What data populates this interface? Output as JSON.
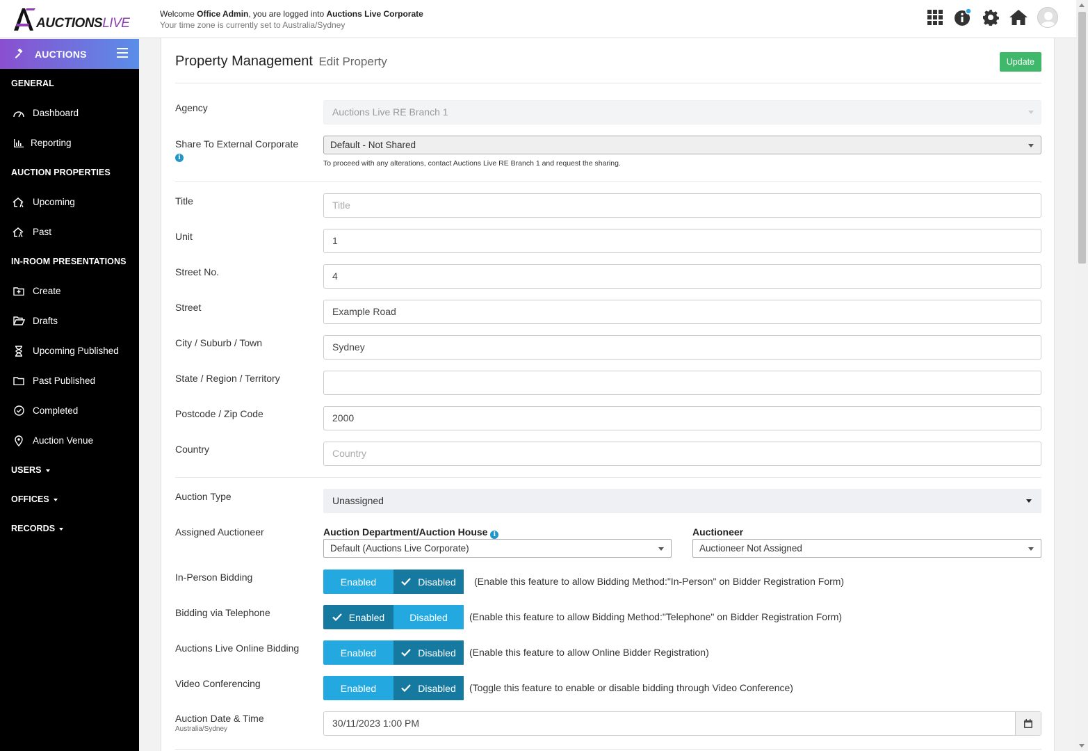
{
  "header": {
    "logo_main": "AUCTIONS",
    "logo_accent": "LIVE",
    "welcome_prefix": "Welcome ",
    "user_name": "Office Admin",
    "welcome_mid": ", you are logged into ",
    "org_name": "Auctions Live Corporate",
    "timezone_text": "Your time zone is currently set to Australia/Sydney",
    "icons": [
      "apps-grid-icon",
      "info-icon",
      "gear-icon",
      "home-icon",
      "user-avatar"
    ]
  },
  "sidebar": {
    "head_label": "AUCTIONS",
    "general_title": "GENERAL",
    "general_items": [
      "Dashboard",
      "Reporting"
    ],
    "auction_properties_title": "AUCTION PROPERTIES",
    "auction_properties_items": [
      "Upcoming",
      "Past"
    ],
    "inroom_title": "IN-ROOM PRESENTATIONS",
    "inroom_items": [
      "Create",
      "Drafts",
      "Upcoming Published",
      "Past Published",
      "Completed",
      "Auction Venue"
    ],
    "users_label": "USERS",
    "offices_label": "OFFICES",
    "records_label": "RECORDS"
  },
  "page": {
    "title": "Property Management",
    "subtitle": "Edit Property",
    "update_label": "Update"
  },
  "form": {
    "agency_label": "Agency",
    "agency_value": "Auctions Live RE Branch 1",
    "share_label": "Share To External Corporate",
    "share_value": "Default - Not Shared",
    "share_note": "To proceed with any alterations, contact Auctions Live RE Branch 1 and request the sharing.",
    "title_label": "Title",
    "title_placeholder": "Title",
    "unit_label": "Unit",
    "unit_value": "1",
    "street_no_label": "Street No.",
    "street_no_value": "4",
    "street_label": "Street",
    "street_value": "Example Road",
    "city_label": "City / Suburb / Town",
    "city_value": "Sydney",
    "state_label": "State / Region / Territory",
    "state_value": "",
    "postcode_label": "Postcode / Zip Code",
    "postcode_value": "2000",
    "country_label": "Country",
    "country_placeholder": "Country",
    "auction_type_label": "Auction Type",
    "auction_type_value": "Unassigned",
    "assigned_auctioneer_label": "Assigned Auctioneer",
    "dept_label": "Auction Department/Auction House",
    "dept_value": "Default (Auctions Live Corporate)",
    "auctioneer_label": "Auctioneer",
    "auctioneer_value": "Auctioneer Not Assigned",
    "toggle_enabled": "Enabled",
    "toggle_disabled": "Disabled",
    "inperson_label": "In-Person Bidding",
    "inperson_desc": "(Enable this feature to allow Bidding Method:\"In-Person\" on Bidder Registration Form)",
    "inperson_state": "Disabled",
    "telephone_label": "Bidding via Telephone",
    "telephone_desc": "(Enable this feature to allow Bidding Method:\"Telephone\" on Bidder Registration Form)",
    "telephone_state": "Enabled",
    "online_label": "Auctions Live Online Bidding",
    "online_desc": "(Enable this feature to allow Online Bidder Registration)",
    "online_state": "Disabled",
    "video_label": "Video Conferencing",
    "video_desc": "(Toggle this feature to enable or disable bidding through Video Conference)",
    "video_state": "Disabled",
    "date_label": "Auction Date & Time",
    "date_tz": "Australia/Sydney",
    "date_value": "30/11/2023 1:00 PM"
  },
  "colors": {
    "update_button": "#3fb86b",
    "toggle_active": "#1579a0",
    "toggle_inactive": "#23a9e0",
    "sidebar_gradient_start": "#8a4fd0",
    "sidebar_gradient_end": "#5a8ee8"
  }
}
